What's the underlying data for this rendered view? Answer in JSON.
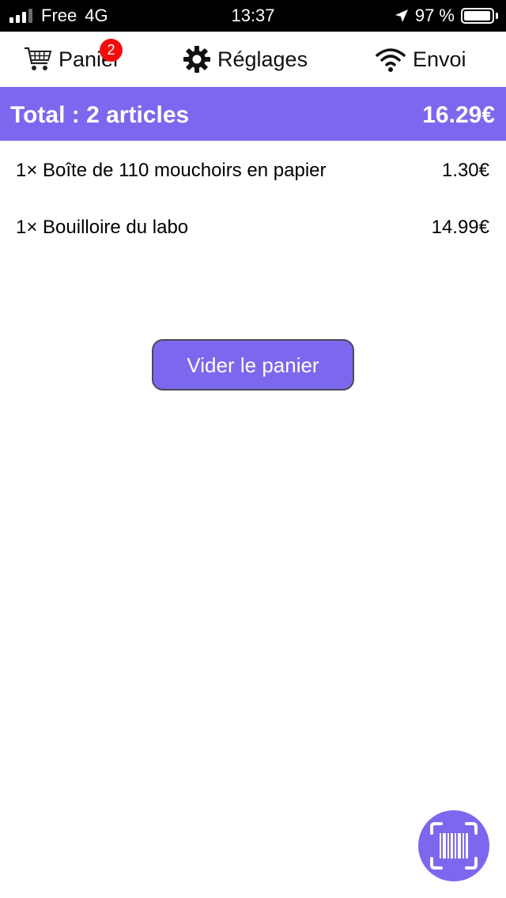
{
  "status_bar": {
    "carrier": "Free",
    "network": "4G",
    "time": "13:37",
    "battery_percent": "97 %",
    "battery_level": 0.97,
    "signal_bars_active": 3,
    "signal_bars_total": 4
  },
  "nav": {
    "cart": {
      "label": "Panier",
      "badge": "2",
      "icon": "cart-icon"
    },
    "settings": {
      "label": "Réglages",
      "icon": "gear-icon"
    },
    "send": {
      "label": "Envoi",
      "icon": "wifi-icon"
    }
  },
  "summary": {
    "label": "Total : 2 articles",
    "amount": "16.29€"
  },
  "items": [
    {
      "description": "1× Boîte de 110 mouchoirs en papier",
      "price": "1.30€"
    },
    {
      "description": "1× Bouilloire du labo",
      "price": "14.99€"
    }
  ],
  "actions": {
    "clear_cart": "Vider le panier",
    "scan_icon": "barcode-scan-icon"
  },
  "colors": {
    "accent": "#7b68ee",
    "badge": "#f20d0d",
    "status_bar_bg": "#000000"
  }
}
